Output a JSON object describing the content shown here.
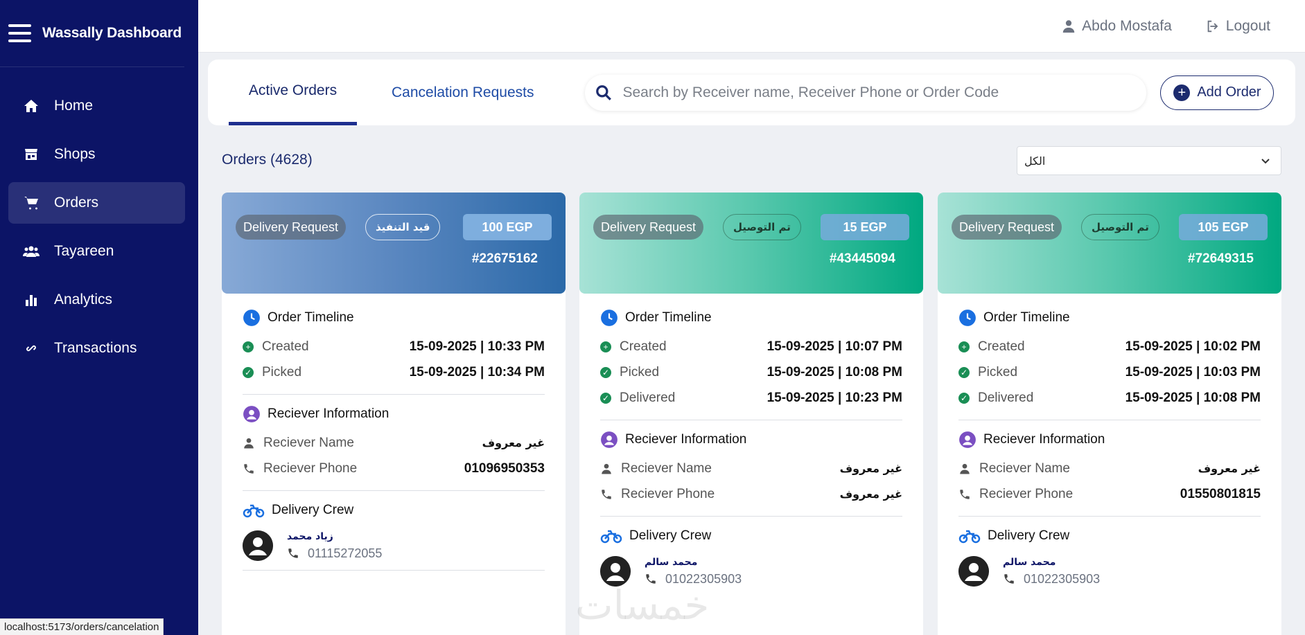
{
  "sidebar": {
    "brand": "Wassally Dashboard",
    "items": [
      {
        "label": "Home",
        "icon": "home-icon"
      },
      {
        "label": "Shops",
        "icon": "store-icon"
      },
      {
        "label": "Orders",
        "icon": "cart-icon",
        "active": true
      },
      {
        "label": "Tayareen",
        "icon": "users-icon"
      },
      {
        "label": "Analytics",
        "icon": "chart-icon"
      },
      {
        "label": "Transactions",
        "icon": "link-icon"
      }
    ]
  },
  "topbar": {
    "user_name": "Abdo Mostafa",
    "logout_label": "Logout"
  },
  "tabs": {
    "active_orders": "Active Orders",
    "cancelation_requests": "Cancelation Requests"
  },
  "search": {
    "placeholder": "Search by Receiver name, Receiver Phone or Order Code"
  },
  "add_order_label": "Add Order",
  "orders_count_label": "Orders (4628)",
  "filter": {
    "selected": "الكل"
  },
  "labels": {
    "timeline": "Order Timeline",
    "receiver_info": "Reciever Information",
    "receiver_name": "Reciever Name",
    "receiver_phone": "Reciever Phone",
    "delivery_crew": "Delivery Crew"
  },
  "orders": [
    {
      "type": "Delivery Request",
      "status": "قيد التنفيذ",
      "price": "100 EGP",
      "code": "#22675162",
      "timeline": [
        {
          "label": "Created",
          "time": "15-09-2025 | 10:33 PM"
        },
        {
          "label": "Picked",
          "time": "15-09-2025 | 10:34 PM"
        }
      ],
      "receiver_name": "غير معروف",
      "receiver_phone": "01096950353",
      "crew_name": "زياد محمد",
      "crew_phone": "01115272055"
    },
    {
      "type": "Delivery Request",
      "status": "تم التوصيل",
      "price": "15 EGP",
      "code": "#43445094",
      "timeline": [
        {
          "label": "Created",
          "time": "15-09-2025 | 10:07 PM"
        },
        {
          "label": "Picked",
          "time": "15-09-2025 | 10:08 PM"
        },
        {
          "label": "Delivered",
          "time": "15-09-2025 | 10:23 PM"
        }
      ],
      "receiver_name": "غير معروف",
      "receiver_phone": "غير معروف",
      "crew_name": "محمد سالم",
      "crew_phone": "01022305903"
    },
    {
      "type": "Delivery Request",
      "status": "تم التوصيل",
      "price": "105 EGP",
      "code": "#72649315",
      "timeline": [
        {
          "label": "Created",
          "time": "15-09-2025 | 10:02 PM"
        },
        {
          "label": "Picked",
          "time": "15-09-2025 | 10:03 PM"
        },
        {
          "label": "Delivered",
          "time": "15-09-2025 | 10:08 PM"
        }
      ],
      "receiver_name": "غير معروف",
      "receiver_phone": "01550801815",
      "crew_name": "محمد سالم",
      "crew_phone": "01022305903"
    }
  ],
  "status_bar_url": "localhost:5173/orders/cancelation",
  "watermark": "خمسات"
}
